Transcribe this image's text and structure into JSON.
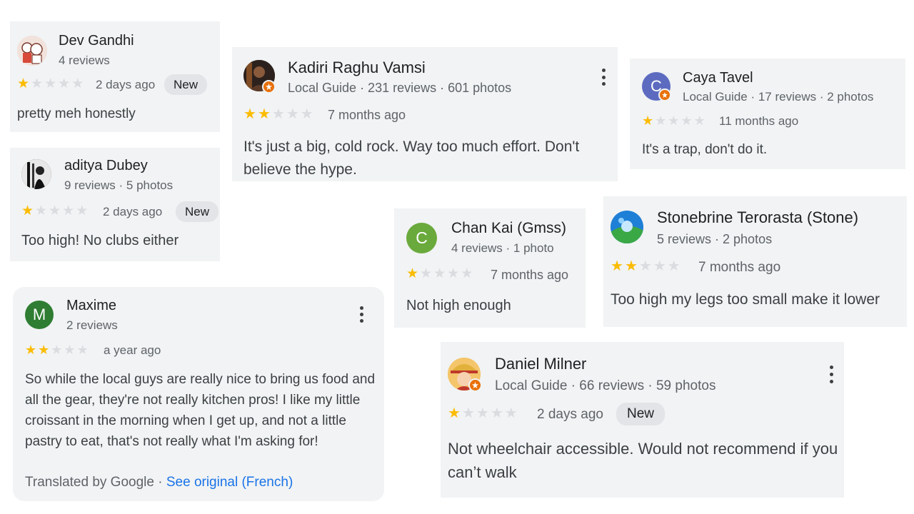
{
  "reviews": [
    {
      "name": "Dev Gandhi",
      "meta": "4 reviews",
      "when": "2 days ago",
      "badge": "New",
      "text": "pretty meh honestly",
      "rating": 1
    },
    {
      "name": "Kadiri Raghu Vamsi",
      "meta": "Local Guide · 231 reviews · 601 photos",
      "when": "7 months ago",
      "text": "It's just a big, cold rock. Way too much effort. Don't believe the hype.",
      "rating": 2
    },
    {
      "name": "Caya Tavel",
      "meta": "Local Guide · 17 reviews · 2 photos",
      "when": "11 months ago",
      "text": "It's a trap, don't do it.",
      "rating": 1,
      "initial": "C"
    },
    {
      "name": "aditya Dubey",
      "meta": "9 reviews · 5 photos",
      "when": "2 days ago",
      "badge": "New",
      "text": "Too high! No clubs either",
      "rating": 1
    },
    {
      "name": "Chan Kai (Gmss)",
      "meta": "4 reviews · 1 photo",
      "when": "7 months ago",
      "text": "Not high enough",
      "rating": 1,
      "initial": "C"
    },
    {
      "name": "Stonebrine Terorasta (Stone)",
      "meta": "5 reviews · 2 photos",
      "when": "7 months ago",
      "text": "Too high my legs too small make it lower",
      "rating": 2
    },
    {
      "name": "Maxime",
      "meta": "2 reviews",
      "when": "a year ago",
      "text": "So while the local guys are really nice to bring us food and all the gear, they're not really kitchen pros! I like my little croissant in the morning when I get up, and not a little pastry to eat, that's not really what I'm asking for!",
      "rating": 2,
      "initial": "M",
      "translated_by": "Translated by Google",
      "see_original": "See original (French)"
    },
    {
      "name": "Daniel Milner",
      "meta": "Local Guide · 66 reviews · 59 photos",
      "when": "2 days ago",
      "badge": "New",
      "text": "Not wheelchair accessible. Would not recommend if you can’t walk",
      "rating": 1
    }
  ],
  "colors": {
    "card_bg": "#f1f3f4",
    "star_filled": "#fbbc04",
    "star_empty": "#dadce0",
    "avatar_caya": "#5c6bc0",
    "avatar_chan": "#6aa93b",
    "avatar_maxime": "#2e7d32",
    "local_guide_badge": "#e8710a",
    "link": "#1a73e8"
  }
}
